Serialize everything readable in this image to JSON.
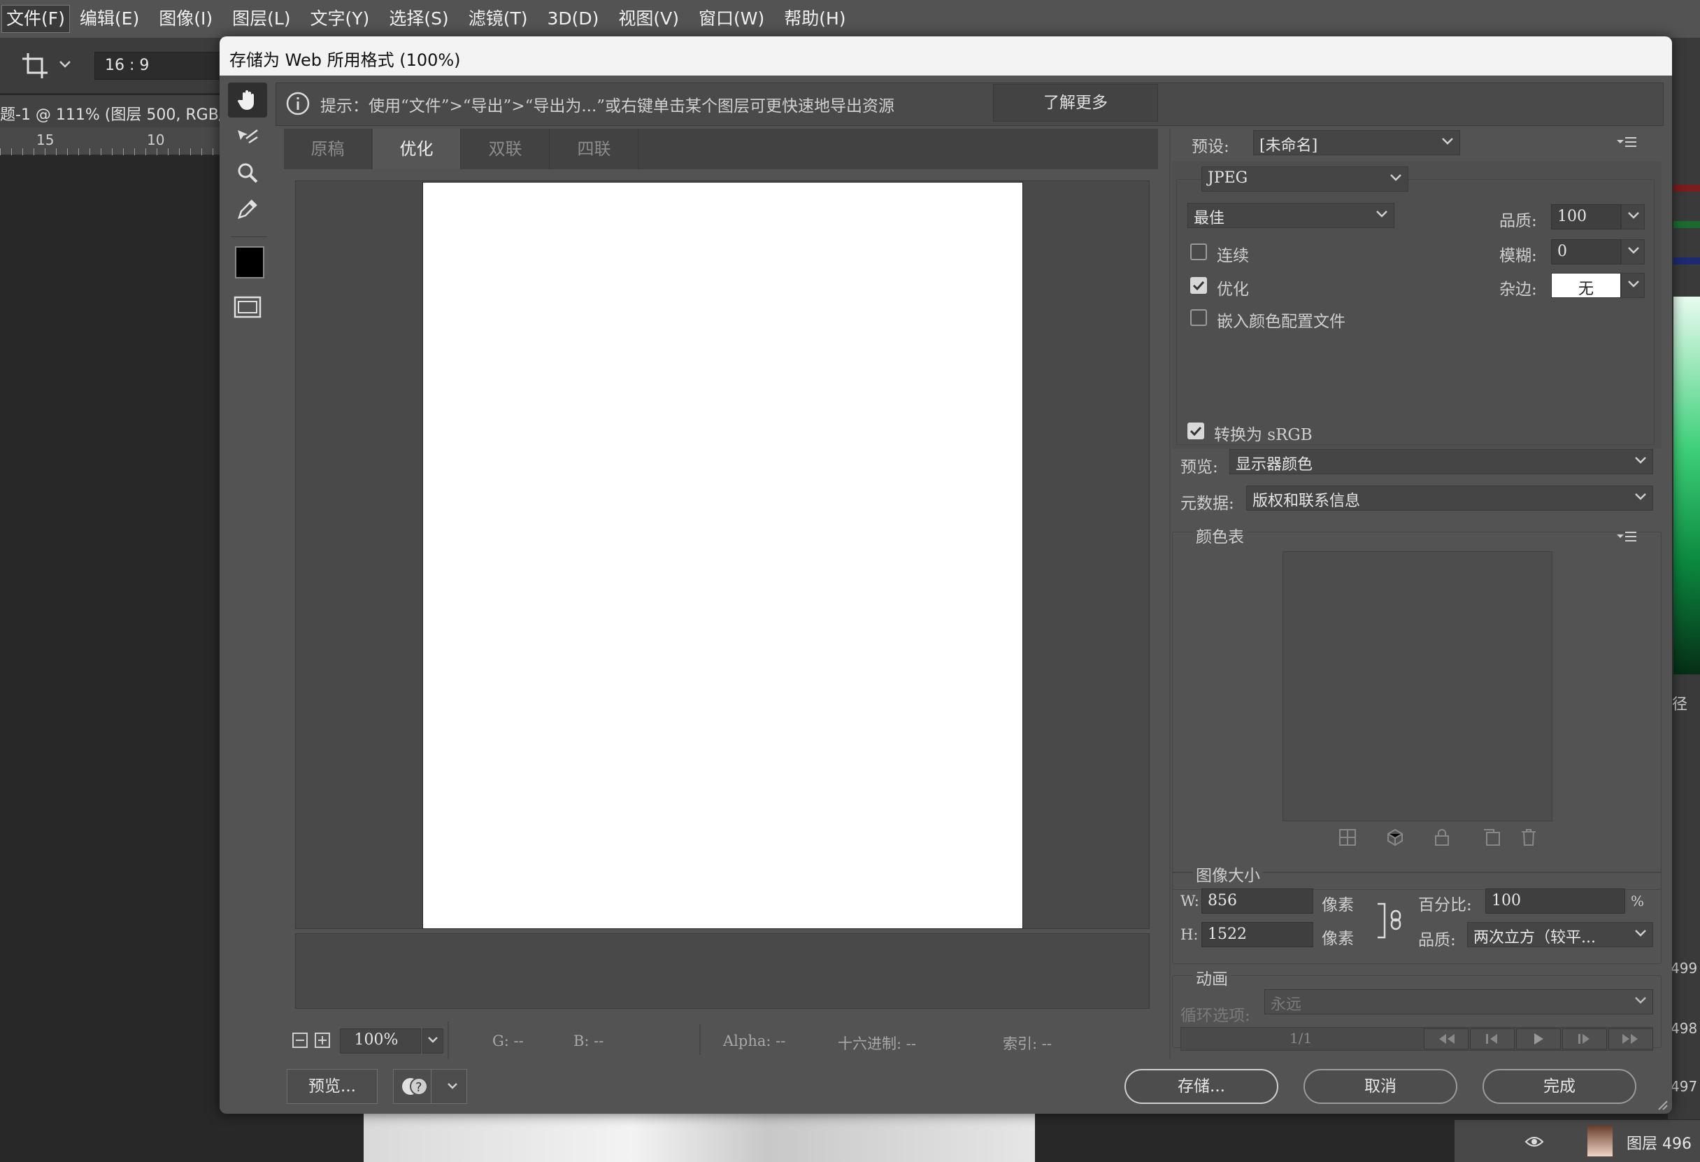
{
  "menubar": {
    "items": [
      "文件(F)",
      "编辑(E)",
      "图像(I)",
      "图层(L)",
      "文字(Y)",
      "选择(S)",
      "滤镜(T)",
      "3D(D)",
      "视图(V)",
      "窗口(W)",
      "帮助(H)"
    ]
  },
  "options": {
    "ratio": "16 : 9"
  },
  "doc": {
    "tab_title": "题-1 @ 111% (图层 500, RGB/",
    "ruler_marks": [
      "15",
      "10"
    ]
  },
  "dialog": {
    "title": "存储为 Web 所用格式 (100%)",
    "hint": "提示：使用“文件”>“导出”>“导出为...”或右键单击某个图层可更快速地导出资源",
    "learn_more": "了解更多",
    "tabs": [
      "原稿",
      "优化",
      "双联",
      "四联"
    ],
    "zoom": "100%",
    "status": {
      "g": "G: --",
      "b": "B: --",
      "alpha": "Alpha: --",
      "hex": "十六进制: --",
      "index": "索引: --"
    },
    "buttons": {
      "preview": "预览...",
      "save": "存储...",
      "cancel": "取消",
      "done": "完成"
    }
  },
  "settings": {
    "preset_label": "预设:",
    "preset_value": "[未命名]",
    "format": "JPEG",
    "quality_preset": "最佳",
    "quality_label": "品质:",
    "quality_value": "100",
    "blur_label": "模糊:",
    "blur_value": "0",
    "matte_label": "杂边:",
    "matte_value": "无",
    "progressive_label": "连续",
    "progressive_checked": false,
    "optimized_label": "优化",
    "optimized_checked": true,
    "embed_profile_label": "嵌入颜色配置文件",
    "embed_profile_checked": false,
    "convert_srgb_label": "转换为 sRGB",
    "convert_srgb_checked": true,
    "preview_label": "预览:",
    "preview_value": "显示器颜色",
    "metadata_label": "元数据:",
    "metadata_value": "版权和联系信息"
  },
  "color_table": {
    "title": "颜色表"
  },
  "image_size": {
    "title": "图像大小",
    "w_label": "W:",
    "w_value": "856",
    "h_label": "H:",
    "h_value": "1522",
    "unit": "像素",
    "percent_label": "百分比:",
    "percent_value": "100",
    "percent_unit": "%",
    "quality_label": "品质:",
    "quality_value": "两次立方（较平..."
  },
  "animation": {
    "title": "动画",
    "loop_label": "循环选项:",
    "loop_value": "永远",
    "frame": "1/1"
  },
  "right_edge": {
    "path": "径",
    "n499": "499",
    "n498": "498",
    "n497": "497",
    "layer_name": "图层 496"
  },
  "colors": {
    "dialog_bg": "#535353",
    "menubar": "#535353",
    "accent_red": "#7a1d1d",
    "accent_green": "#1c6b2e",
    "accent_blue": "#1d2a73"
  }
}
